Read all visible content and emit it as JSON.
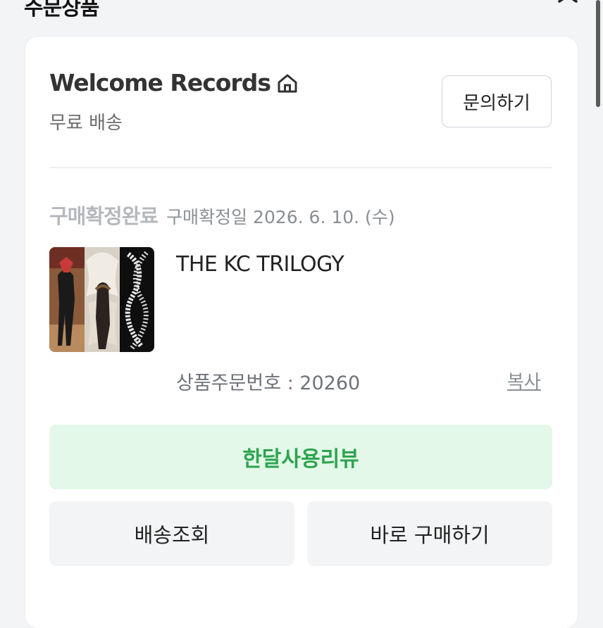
{
  "header": {
    "title": "주문상품",
    "close_icon": "close-icon"
  },
  "shop": {
    "name": "Welcome Records",
    "home_icon": "home-icon",
    "shipping": "무료 배송",
    "inquiry_label": "문의하기"
  },
  "order": {
    "status": "구매확정완료",
    "confirm_date": "구매확정일 2026. 6. 10. (수)",
    "product_title": "THE KC TRILOGY",
    "order_number": "상품주문번호 : 20260",
    "copy_label": "복사"
  },
  "actions": {
    "review_label": "한달사용리뷰",
    "track_label": "배송조회",
    "buy_again_label": "바로 구매하기"
  },
  "colors": {
    "background": "#f2f4f6",
    "review_bg": "#e3f8e8",
    "review_text": "#2ea44f",
    "status_text": "#b4b8bd"
  }
}
